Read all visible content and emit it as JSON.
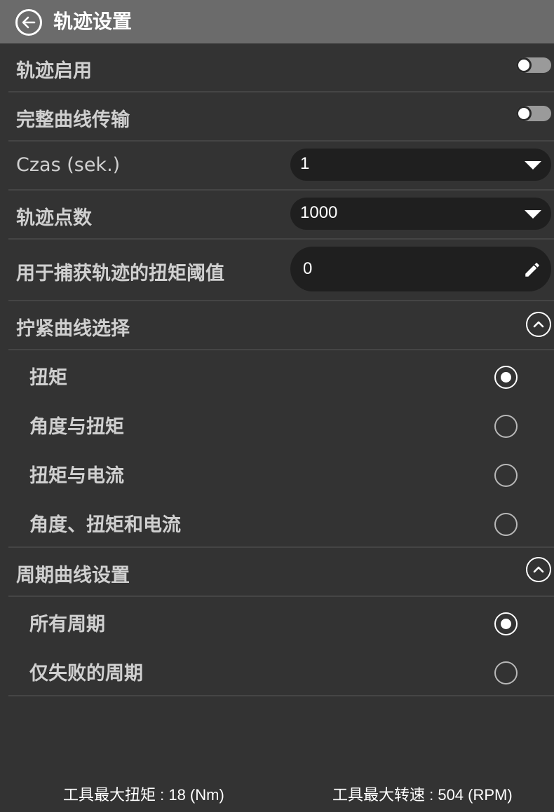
{
  "header": {
    "title": "轨迹设置"
  },
  "settings": {
    "trace_enable_label": "轨迹启用",
    "full_curve_label": "完整曲线传输",
    "time_label": "Czas (sek.)",
    "time_value": "1",
    "points_label": "轨迹点数",
    "points_value": "1000",
    "threshold_label": "用于捕获轨迹的扭矩阈值",
    "threshold_value": "0"
  },
  "tightening": {
    "title": "拧紧曲线选择",
    "options": [
      "扭矩",
      "角度与扭矩",
      "扭矩与电流",
      "角度、扭矩和电流"
    ],
    "selected_index": 0
  },
  "cycle": {
    "title": "周期曲线设置",
    "options": [
      "所有周期",
      "仅失败的周期"
    ],
    "selected_index": 0
  },
  "footer": {
    "max_torque": "工具最大扭矩 : 18 (Nm)",
    "max_speed": "工具最大转速 : 504 (RPM)"
  },
  "colors": {
    "background": "#333333",
    "header": "#6b6b6b",
    "input_bg": "#1f1f1f"
  }
}
